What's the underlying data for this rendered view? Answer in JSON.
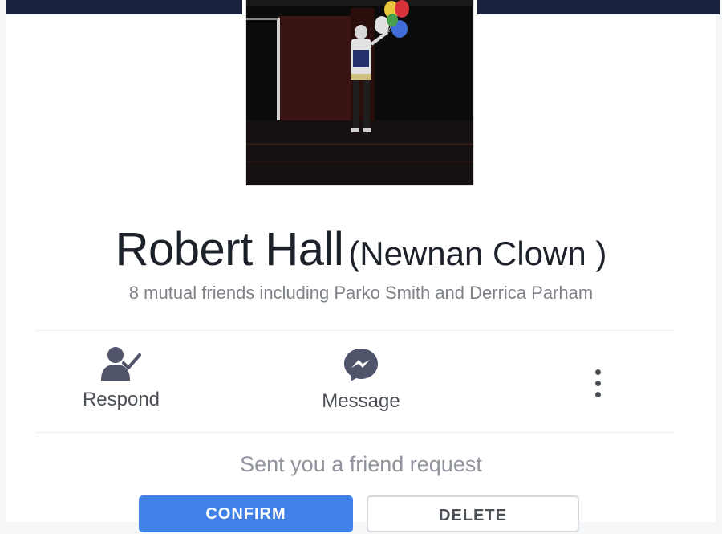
{
  "profile": {
    "name": "Robert Hall",
    "nickname": "(Newnan Clown )",
    "mutual_friends": "8 mutual friends including Parko Smith and Derrica Parham"
  },
  "actions": {
    "respond_label": "Respond",
    "message_label": "Message"
  },
  "request": {
    "text": "Sent you a friend request",
    "confirm_label": "CONFIRM",
    "delete_label": "DELETE"
  },
  "colors": {
    "cover": "#1a2240",
    "confirm_button": "#4080e8",
    "text_primary": "#1d2129",
    "text_secondary": "#7f8389"
  },
  "icons": {
    "respond": "person-check-icon",
    "message": "messenger-icon",
    "more": "more-vertical-icon"
  }
}
